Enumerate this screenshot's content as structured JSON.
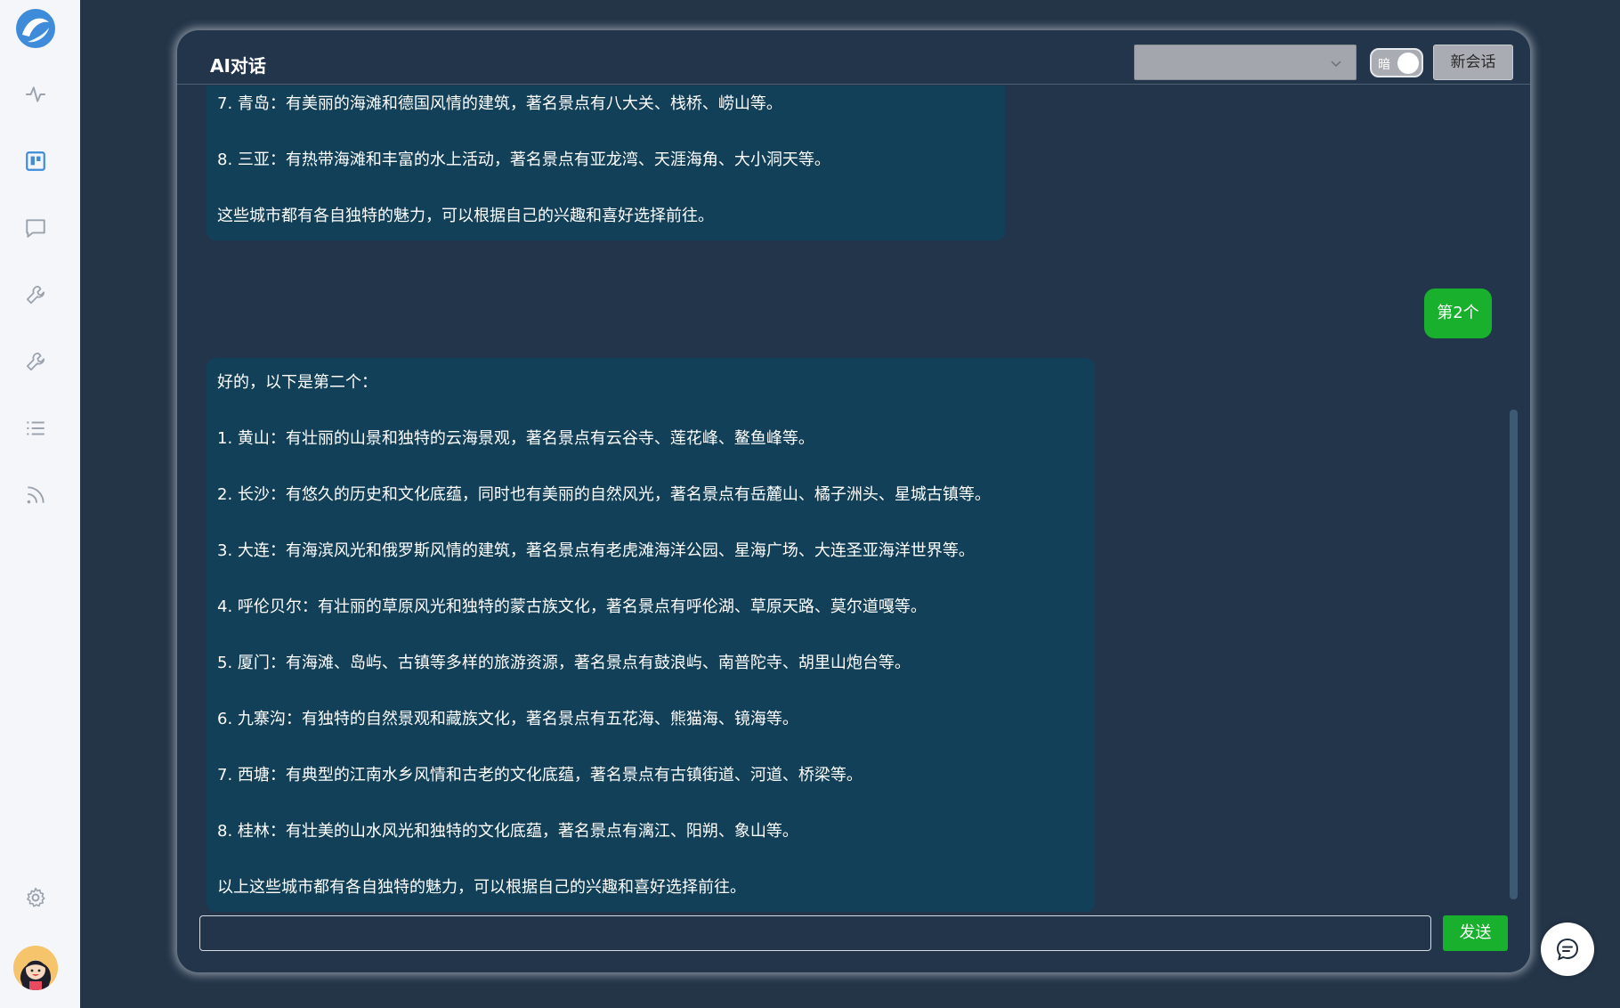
{
  "app": {
    "title": "AI对话"
  },
  "colors": {
    "accent_green": "#18b02c",
    "ai_bubble": "#124058",
    "panel_bg": "#22354a",
    "sidebar_bg": "#f4f6fa",
    "sidebar_icon": "#9aa3ad",
    "sidebar_active": "#3d8bd9"
  },
  "sidebar": {
    "logo_icon": "app-logo-icon",
    "items": [
      {
        "icon": "activity-icon",
        "active": false
      },
      {
        "icon": "board-icon",
        "active": true
      },
      {
        "icon": "chat-icon",
        "active": false
      },
      {
        "icon": "wrench-icon",
        "active": false
      },
      {
        "icon": "wrench-icon",
        "active": false
      },
      {
        "icon": "list-icon",
        "active": false
      },
      {
        "icon": "rss-icon",
        "active": false
      }
    ],
    "settings_icon": "gear-icon",
    "avatar_icon": "avatar-icon"
  },
  "header": {
    "model_select_value": "",
    "theme_toggle_label": "暗",
    "theme_toggle_on": true,
    "new_chat_label": "新会话"
  },
  "messages": [
    {
      "role": "assistant",
      "lines": [
        "7. 青岛：有美丽的海滩和德国风情的建筑，著名景点有八大关、栈桥、崂山等。",
        "8. 三亚：有热带海滩和丰富的水上活动，著名景点有亚龙湾、天涯海角、大小洞天等。",
        "这些城市都有各自独特的魅力，可以根据自己的兴趣和喜好选择前往。"
      ]
    },
    {
      "role": "user",
      "text": "第2个"
    },
    {
      "role": "assistant",
      "lines": [
        "好的，以下是第二个：",
        "1. 黄山：有壮丽的山景和独特的云海景观，著名景点有云谷寺、莲花峰、鳌鱼峰等。",
        "2. 长沙：有悠久的历史和文化底蕴，同时也有美丽的自然风光，著名景点有岳麓山、橘子洲头、星城古镇等。",
        "3. 大连：有海滨风光和俄罗斯风情的建筑，著名景点有老虎滩海洋公园、星海广场、大连圣亚海洋世界等。",
        "4. 呼伦贝尔：有壮丽的草原风光和独特的蒙古族文化，著名景点有呼伦湖、草原天路、莫尔道嘎等。",
        "5. 厦门：有海滩、岛屿、古镇等多样的旅游资源，著名景点有鼓浪屿、南普陀寺、胡里山炮台等。",
        "6. 九寨沟：有独特的自然景观和藏族文化，著名景点有五花海、熊猫海、镜海等。",
        "7. 西塘：有典型的江南水乡风情和古老的文化底蕴，著名景点有古镇街道、河道、桥梁等。",
        "8. 桂林：有壮美的山水风光和独特的文化底蕴，著名景点有漓江、阳朔、象山等。",
        "以上这些城市都有各自独特的魅力，可以根据自己的兴趣和喜好选择前往。"
      ]
    }
  ],
  "input": {
    "value": "",
    "placeholder": "",
    "send_label": "发送"
  },
  "floating": {
    "icon": "chat-bubble-icon"
  }
}
